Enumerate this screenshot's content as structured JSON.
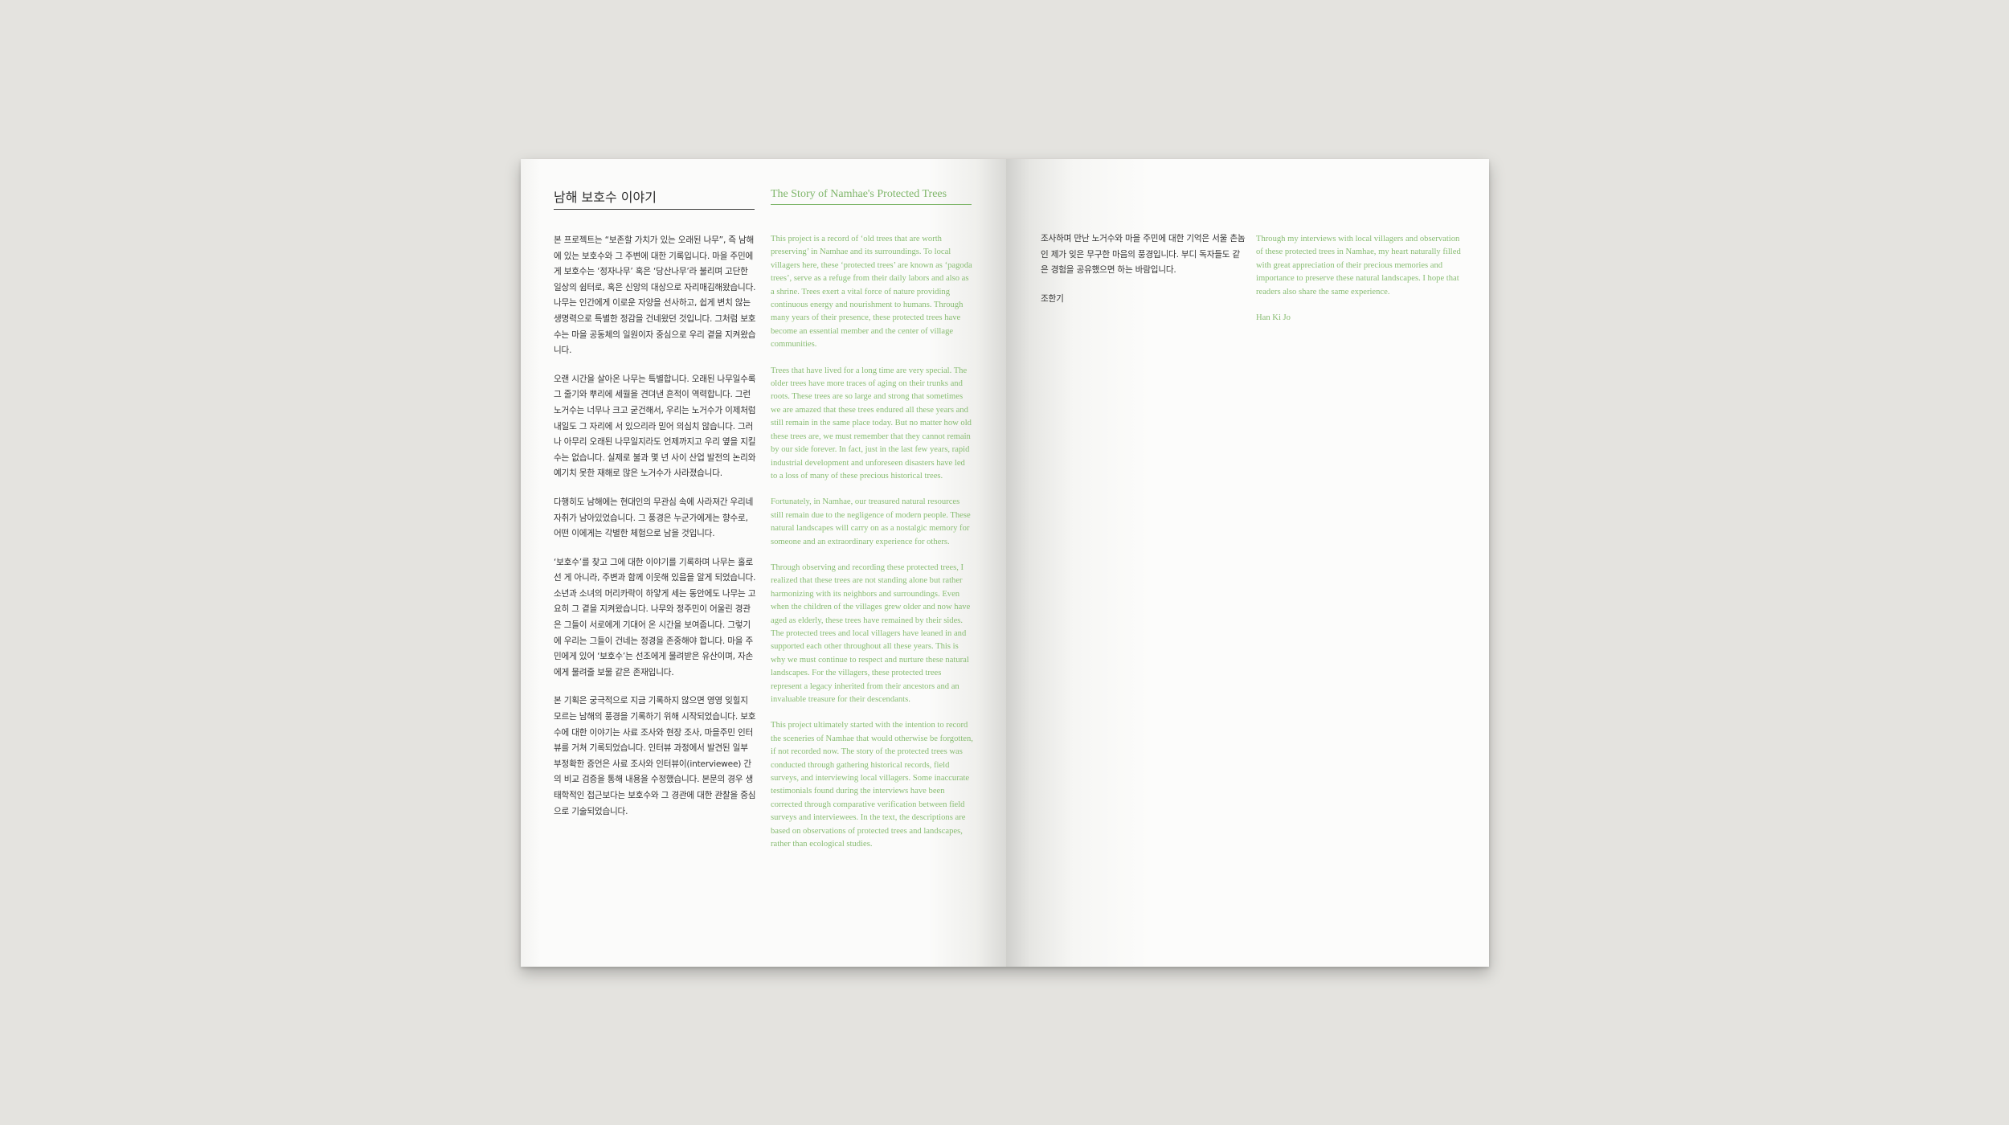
{
  "left_page": {
    "title_ko": "남해 보호수 이야기",
    "title_en": "The Story of Namhae's Protected Trees",
    "ko_paragraphs": [
      "본 프로젝트는 “보존할 가치가 있는 오래된 나무”, 즉 남해에 있는 보호수와 그 주변에 대한 기록입니다. 마을 주민에게 보호수는 ‘정자나무’ 혹은 ‘당산나무’라 불리며 고단한 일상의 쉼터로, 혹은 신앙의 대상으로 자리매김해왔습니다. 나무는 인간에게 이로운 자양을 선사하고, 쉽게 변치 않는 생명력으로 특별한 정감을 건네왔던 것입니다. 그처럼 보호수는 마을 공동체의 일원이자 중심으로 우리 곁을 지켜왔습니다.",
      "오랜 시간을 살아온 나무는 특별합니다. 오래된 나무일수록 그 줄기와 뿌리에 세월을 견뎌낸 흔적이 역력합니다. 그런 노거수는 너무나 크고 굳건해서, 우리는 노거수가 이제처럼 내일도 그 자리에 서 있으리라 믿어 의심치 않습니다. 그러나 아무리 오래된 나무일지라도 언제까지고 우리 옆을 지킬 수는 없습니다. 실제로 불과 몇 년 사이 산업 발전의 논리와 예기치 못한 재해로 많은 노거수가 사라졌습니다.",
      "다행히도 남해에는 현대인의 무관심 속에 사라져간 우리네 자취가 남아있었습니다. 그 풍경은 누군가에게는 향수로, 어떤 이에게는 각별한 체험으로 남을 것입니다.",
      "‘보호수’를 찾고 그에 대한 이야기를 기록하며 나무는 홀로 선 게 아니라, 주변과 함께 이웃해 있음을 알게 되었습니다. 소년과 소녀의 머리카락이 하얗게 세는 동안에도 나무는 고요히 그 곁을 지켜왔습니다. 나무와 정주민이 어울린 경관은 그들이 서로에게 기대어 온 시간을 보여줍니다. 그렇기에 우리는 그들이 건네는 정경을 존중해야 합니다. 마을 주민에게 있어 ‘보호수’는 선조에게 물려받은 유산이며, 자손에게 물려줄 보물 같은 존재입니다.",
      "본 기획은 궁극적으로 지금 기록하지 않으면 영영 잊힐지 모르는 남해의 풍경을 기록하기 위해 시작되었습니다. 보호수에 대한 이야기는 사료 조사와 현장 조사, 마을주민 인터뷰를 거쳐 기록되었습니다. 인터뷰 과정에서 발견된 일부 부정확한 증언은 사료 조사와 인터뷰이(interviewee) 간의 비교 검증을 통해 내용을 수정했습니다. 본문의 경우 생태학적인 접근보다는 보호수와 그 경관에 대한 관찰을 중심으로 기술되었습니다."
    ],
    "en_paragraphs": [
      "This project is a record of ‘old trees that are worth preserving’ in Namhae and its surroundings. To local villagers here, these ‘protected trees’ are known as ‘pagoda trees’, serve as a refuge from their daily labors and also as a shrine. Trees exert a vital force of nature providing continuous energy and nourishment to humans. Through many years of their presence, these protected trees have become an essential member and the center of village communities.",
      "Trees that have lived for a long time are very special. The older trees have more traces of aging on their trunks and roots. These trees are so large and strong that sometimes we are amazed that these trees endured all these years and still remain in the same place today. But no matter how old these trees are, we must remember that they cannot remain by our side forever. In fact, just in the last few years, rapid industrial development and unforeseen disasters have led to a loss of many of these precious historical trees.",
      "Fortunately, in Namhae, our treasured natural resources still remain due to the negligence of modern people. These natural landscapes will carry on as a nostalgic memory for someone and an extraordinary experience for others.",
      "Through observing and recording these protected trees, I realized that these trees are not standing alone but rather harmonizing with its neighbors and surroundings. Even when the children of the villages grew older and now have aged as elderly, these trees have remained by their sides. The protected trees and local villagers have leaned in and supported each other throughout all these years. This is why we must continue to respect and nurture these natural landscapes. For the villagers, these protected trees represent a legacy inherited from their ancestors and an invaluable treasure for their descendants.",
      "This project ultimately started with the intention to record the sceneries of Namhae that would otherwise be forgotten, if not recorded now. The story of the protected trees was conducted through gathering historical records, field surveys, and interviewing local villagers. Some inaccurate testimonials found during the interviews have been corrected through comparative verification between field surveys and interviewees. In the text, the descriptions are based on observations of protected trees and landscapes, rather than ecological studies."
    ]
  },
  "right_page": {
    "ko_paragraph": "조사하며 만난 노거수와 마을 주민에 대한 기억은 서울 촌놈인 제가 잊은 무구한 마음의 풍경입니다. 부디 독자들도 같은 경험을 공유했으면 하는 바람입니다.",
    "ko_signature": "조한기",
    "en_paragraph": "Through my interviews with local villagers and observation of these protected trees in Namhae, my heart naturally filled with great appreciation of their precious memories and importance to preserve these natural landscapes. I hope that readers also share the same experience.",
    "en_signature": "Han Ki Jo"
  },
  "colors": {
    "background": "#e4e3df",
    "paper": "#fbfbfa",
    "korean_text": "#333333",
    "english_text": "#88bc72"
  }
}
